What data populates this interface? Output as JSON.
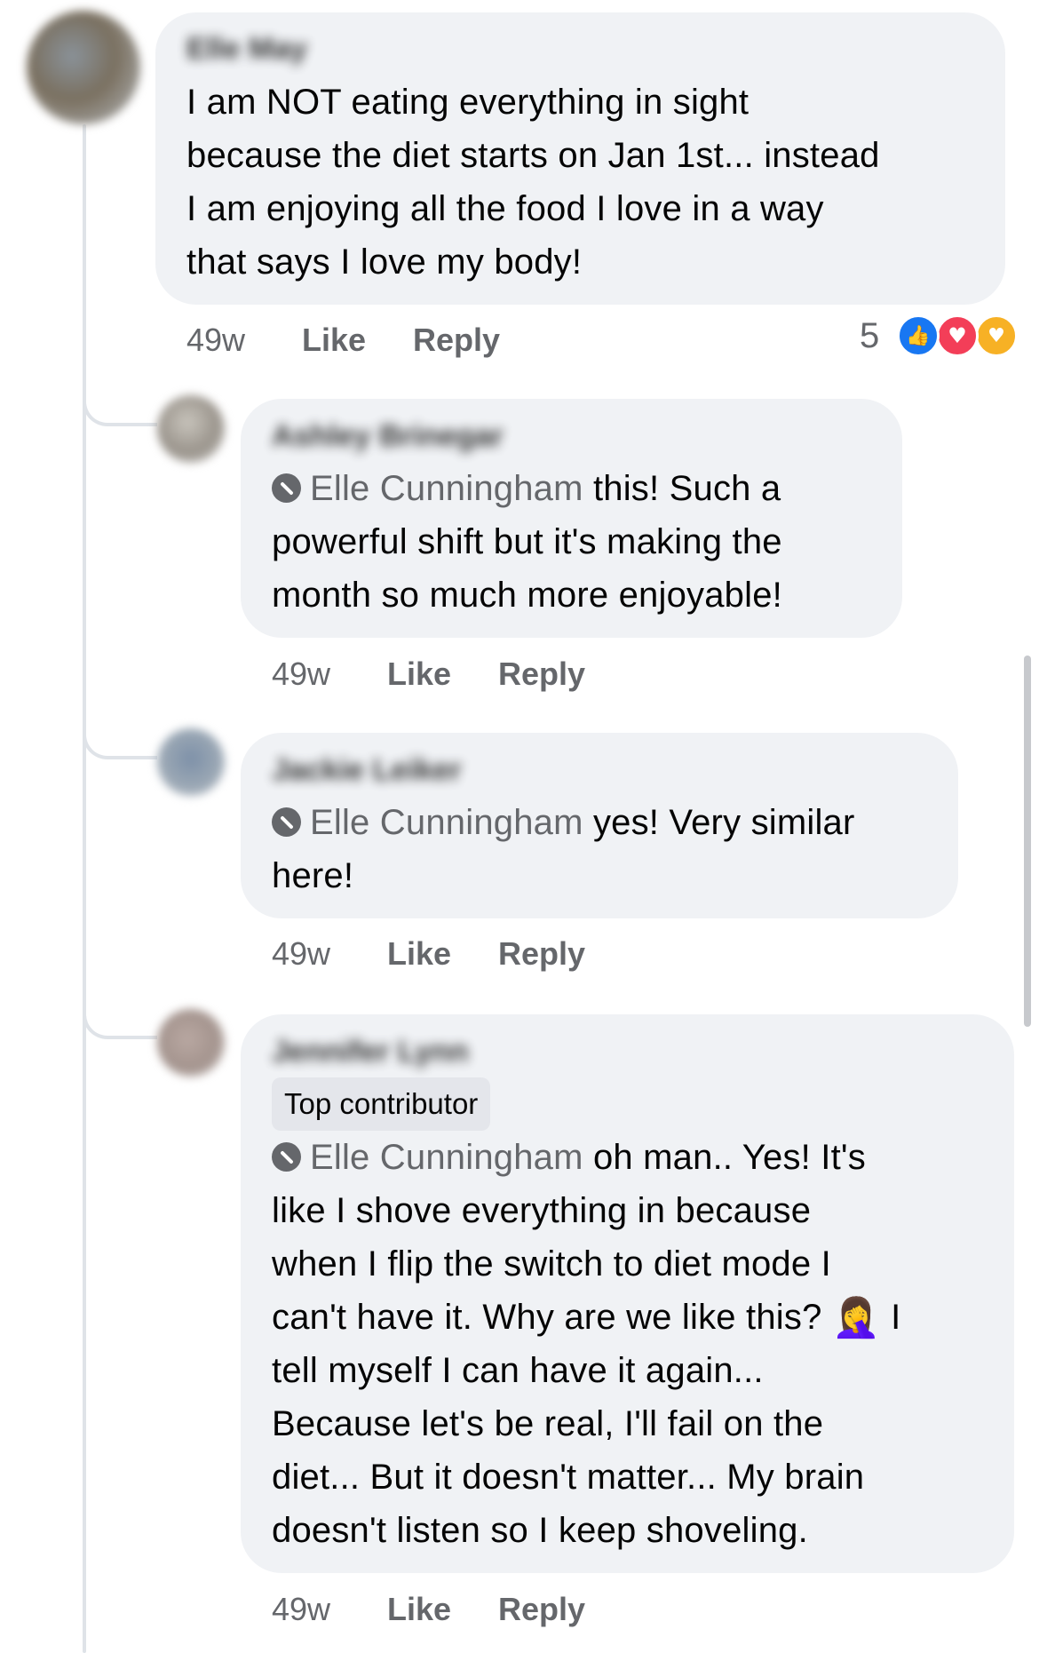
{
  "comments": [
    {
      "author": "Elle May",
      "text": [
        "I am NOT eating everything in sight",
        "because the diet starts on Jan 1st... instead",
        "I am enjoying all the food I love in a way",
        "that says I love my body!"
      ],
      "time": "49w",
      "like_label": "Like",
      "reply_label": "Reply",
      "reaction_count": "5",
      "reactions": [
        "like-icon",
        "love-icon",
        "care-icon"
      ]
    },
    {
      "author": "Ashley Brinegar",
      "mention": "Elle Cunningham",
      "text": [
        " this! Such a",
        "powerful shift but it's making the",
        "month so much more enjoyable!"
      ],
      "time": "49w",
      "like_label": "Like",
      "reply_label": "Reply"
    },
    {
      "author": "Jackie Leiker",
      "mention": "Elle Cunningham",
      "text": [
        " yes! Very similar",
        "here!"
      ],
      "time": "49w",
      "like_label": "Like",
      "reply_label": "Reply"
    },
    {
      "author": "Jennifer Lynn",
      "badge": "Top contributor",
      "mention": "Elle Cunningham",
      "text": [
        " oh man.. Yes! It's",
        "like I shove everything in because",
        "when I flip the switch to diet mode I",
        "can't have it. Why are we like this? ",
        "tell myself I can have it again...",
        "Because let's be real, I'll fail on the",
        "diet... But it doesn't matter... My brain",
        "doesn't listen so I keep shoveling."
      ],
      "emoji": "🤦‍♀️",
      "emoji_after": " I",
      "time": "49w",
      "like_label": "Like",
      "reply_label": "Reply"
    }
  ]
}
